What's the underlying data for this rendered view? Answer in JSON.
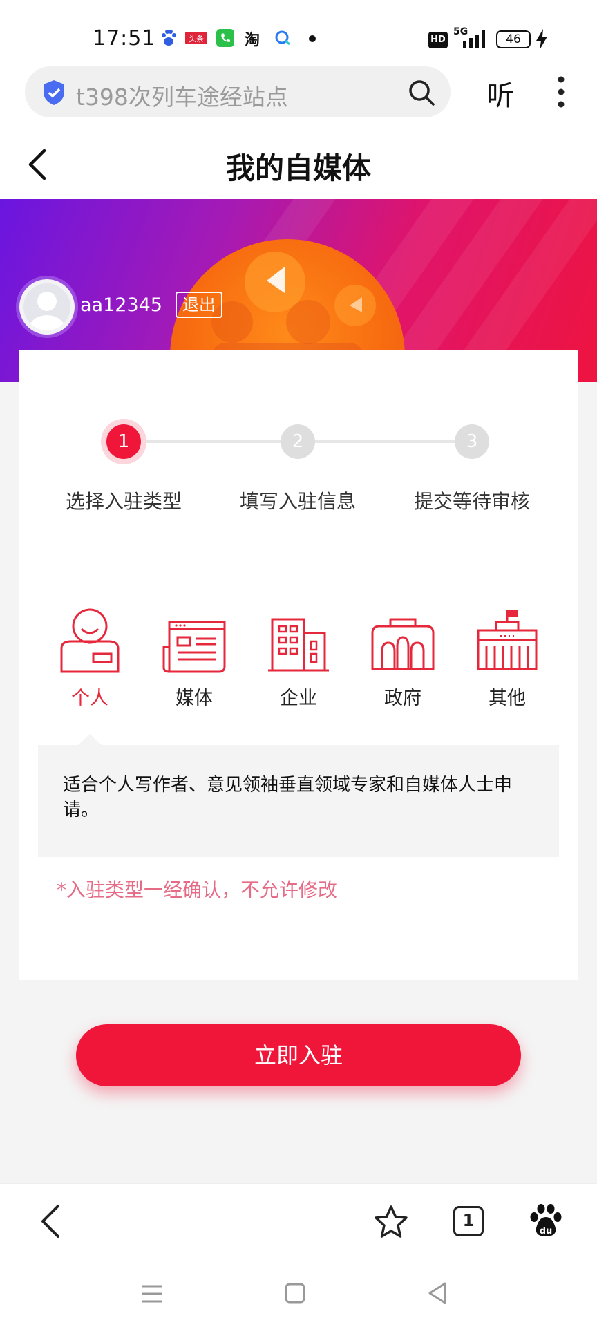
{
  "status_bar": {
    "time": "17:51",
    "notification_icons": [
      "baidu-icon",
      "toutiao-icon",
      "phone-icon",
      "taobao-icon",
      "message-icon",
      "dot-icon"
    ],
    "toutiao_label": "头条",
    "taobao_label": "淘",
    "hd_label": "HD",
    "network_label": "5G",
    "battery": "46"
  },
  "search": {
    "query": "t398次列车途经站点",
    "listen_label": "听"
  },
  "header": {
    "title": "我的自媒体"
  },
  "profile": {
    "username": "aa12345",
    "logout_label": "退出"
  },
  "steps": [
    {
      "number": "1",
      "label": "选择入驻类型",
      "active": true
    },
    {
      "number": "2",
      "label": "填写入驻信息",
      "active": false
    },
    {
      "number": "3",
      "label": "提交等待审核",
      "active": false
    }
  ],
  "account_types": [
    {
      "label": "个人",
      "icon": "person-icon",
      "selected": true
    },
    {
      "label": "媒体",
      "icon": "newspaper-icon",
      "selected": false
    },
    {
      "label": "企业",
      "icon": "building-icon",
      "selected": false
    },
    {
      "label": "政府",
      "icon": "government-icon",
      "selected": false
    },
    {
      "label": "其他",
      "icon": "institution-icon",
      "selected": false
    }
  ],
  "description": "适合个人写作者、意见领袖垂直领域专家和自媒体人士申请。",
  "warning": "*入驻类型一经确认，不允许修改",
  "submit_label": "立即入驻",
  "toolbar": {
    "tab_count": "1",
    "baidu_label": "du"
  },
  "colors": {
    "accent": "#f0163a",
    "warning": "#e56b86",
    "icon_red": "#e5283b"
  }
}
